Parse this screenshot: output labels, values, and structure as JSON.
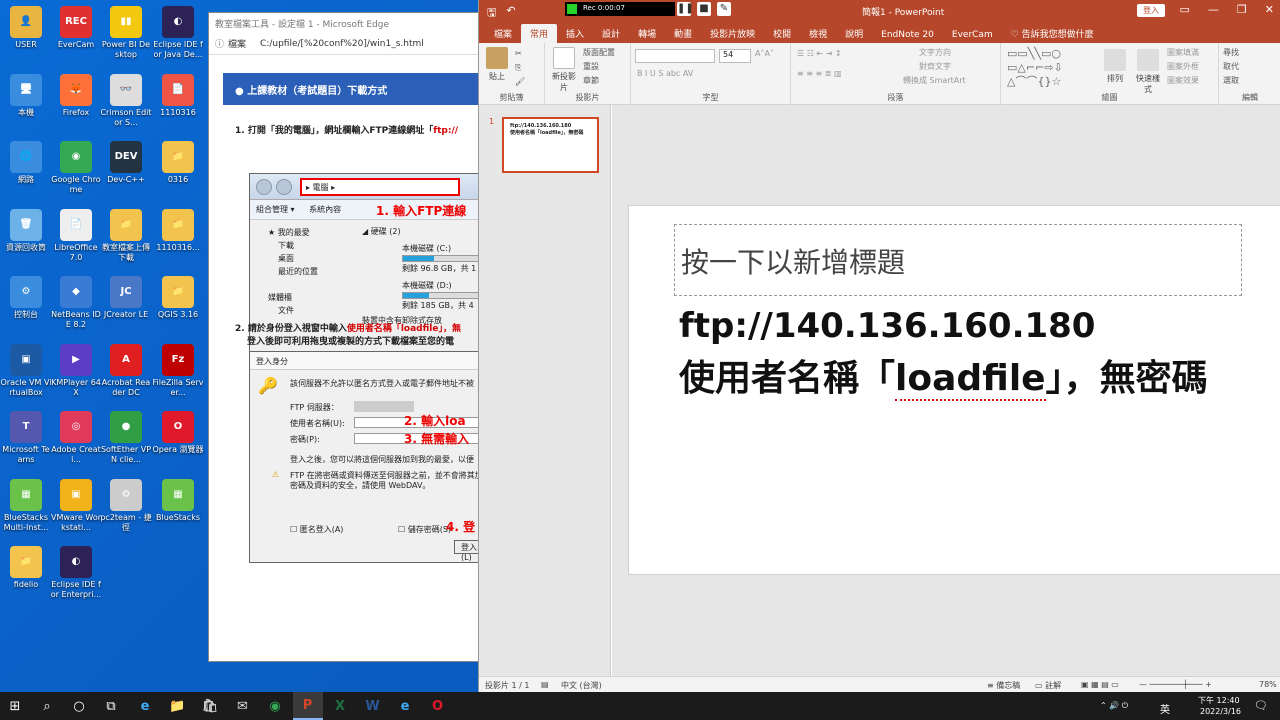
{
  "desktop": {
    "icons": [
      {
        "label": "USER",
        "glyph": "👤",
        "color": "#e8b640"
      },
      {
        "label": "EverCam",
        "glyph": "REC",
        "color": "#e03030"
      },
      {
        "label": "Power BI Desktop",
        "glyph": "▮▮",
        "color": "#f2c811"
      },
      {
        "label": "Eclipse IDE for Java De...",
        "glyph": "◐",
        "color": "#2c2255"
      },
      {
        "label": "本機",
        "glyph": "🖥",
        "color": "#3a8dde"
      },
      {
        "label": "Firefox",
        "glyph": "🦊",
        "color": "#ff7139"
      },
      {
        "label": "Crimson Editor S...",
        "glyph": "👓",
        "color": "#ddd"
      },
      {
        "label": "1110316",
        "glyph": "📄",
        "color": "#e54"
      },
      {
        "label": "網路",
        "glyph": "🌐",
        "color": "#3a8dde"
      },
      {
        "label": "Google Chrome",
        "glyph": "◉",
        "color": "#34a853"
      },
      {
        "label": "Dev-C++",
        "glyph": "DEV",
        "color": "#234"
      },
      {
        "label": "0316",
        "glyph": "📁",
        "color": "#f3c44d"
      },
      {
        "label": "資源回收筒",
        "glyph": "🗑",
        "color": "#6cb2e8"
      },
      {
        "label": "LibreOffice 7.0",
        "glyph": "📄",
        "color": "#eee"
      },
      {
        "label": "教室檔案上傳下載",
        "glyph": "📁",
        "color": "#f3c44d"
      },
      {
        "label": "1110316...",
        "glyph": "📁",
        "color": "#f3c44d"
      },
      {
        "label": "控制台",
        "glyph": "⚙",
        "color": "#3a8dde"
      },
      {
        "label": "NetBeans IDE 8.2",
        "glyph": "◆",
        "color": "#3a7bd5"
      },
      {
        "label": "JCreator LE",
        "glyph": "JC",
        "color": "#4a78c8"
      },
      {
        "label": "QGIS 3.16",
        "glyph": "📁",
        "color": "#f3c44d"
      },
      {
        "label": "Oracle VM VirtualBox",
        "glyph": "▣",
        "color": "#1c5aa6"
      },
      {
        "label": "KMPlayer 64X",
        "glyph": "▶",
        "color": "#5b3cc4"
      },
      {
        "label": "Acrobat Reader DC",
        "glyph": "A",
        "color": "#e02020"
      },
      {
        "label": "FileZilla Server...",
        "glyph": "Fz",
        "color": "#bf0000"
      },
      {
        "label": "Microsoft Teams",
        "glyph": "T",
        "color": "#5558af"
      },
      {
        "label": "Adobe Creati...",
        "glyph": "◎",
        "color": "#e03a5a"
      },
      {
        "label": "SoftEther VPN clie...",
        "glyph": "●",
        "color": "#2f9e44"
      },
      {
        "label": "Opera 瀏覽器",
        "glyph": "O",
        "color": "#e01a2a"
      },
      {
        "label": "BlueStacks Multi-Inst...",
        "glyph": "▦",
        "color": "#6bc24a"
      },
      {
        "label": "VMware Workstati...",
        "glyph": "▣",
        "color": "#f2b21a"
      },
      {
        "label": "pc2team - 捷徑",
        "glyph": "⚙",
        "color": "#ccc"
      },
      {
        "label": "BlueStacks",
        "glyph": "▦",
        "color": "#6bc24a"
      },
      {
        "label": "fidelio",
        "glyph": "📁",
        "color": "#f3c44d"
      },
      {
        "label": "Eclipse IDE for Enterpri...",
        "glyph": "◐",
        "color": "#2c2255"
      }
    ]
  },
  "edge": {
    "title": "教室檔案工具 - 設定檔 1 - Microsoft Edge",
    "addr_icon": "ⓘ",
    "addr_prefix": "檔案",
    "url": "C:/upfile/[%20conf%20]/win1_s.html",
    "banner": "上課教材（考試題目）下載方式",
    "step1_prefix": "1. 打開「我的電腦」，網址欄輸入FTP連線網址「",
    "step1_red": "ftp://",
    "explorer": {
      "address": "▸ 電腦 ▸",
      "menu_org": "組合管理 ▾",
      "menu_props": "系統內容",
      "callout": "1. 輸入FTP連線",
      "tree": [
        "★ 我的最愛",
        "下載",
        "桌面",
        "最近的位置",
        "",
        "媒體櫃",
        "文件"
      ],
      "drives_header": "◢ 硬碟 (2)",
      "drive_c": "本機磁碟 (C:)",
      "drive_c_free": "剩餘 96.8 GB，共 1",
      "drive_c_used": 0.35,
      "drive_d": "本機磁碟 (D:)",
      "drive_d_free": "剩餘 185 GB，共 4",
      "drive_d_used": 0.3,
      "drive_more": "裝置中含有卸除式存放"
    },
    "step2_prefix": "2. 請於身份登入視窗中輸入",
    "step2_red": "使用者名稱「loadfile」，無",
    "step2_line2": "登入後即可利用拖曳或複製的方式下載檔案至您的電",
    "login": {
      "title": "登入身分",
      "msg": "該伺服器不允許以匿名方式登入或電子郵件地址不被",
      "server_label": "FTP 伺服器：",
      "user_label": "使用者名稱(U):",
      "pass_label": "密碼(P):",
      "callout2": "2. 輸入loa",
      "callout3": "3. 無需輸入",
      "note": "登入之後，您可以將這個伺服器加到我的最愛，以便",
      "warn": "FTP 在將密碼或資料傳送至伺服器之前，並不會將其加",
      "warn2": "密碼及資料的安全，請使用 WebDAV。",
      "anon": "☐ 匿名登入(A)",
      "save": "☐ 儲存密碼(S)",
      "callout4": "4. 登",
      "login_btn": "登入(L)"
    }
  },
  "ppt": {
    "title": "簡報1 - PowerPoint",
    "login": "登入",
    "rec_time": "Rec 0:00:07",
    "tabs": [
      "檔案",
      "常用",
      "插入",
      "設計",
      "轉場",
      "動畫",
      "投影片放映",
      "校閱",
      "檢視",
      "說明",
      "EndNote 20",
      "EverCam",
      "♡ 告訴我您想做什麼"
    ],
    "ribbon": {
      "paste": "貼上",
      "clipboard": "剪貼簿",
      "new_slide": "新投影片",
      "layout": "版面配置",
      "reset": "重設",
      "section": "章節",
      "slides": "投影片",
      "font": "字型",
      "font_size": "54",
      "paragraph": "段落",
      "text_dir": "文字方向",
      "align_text": "對齊文字",
      "smartart": "轉換成 SmartArt",
      "drawing": "繪圖",
      "arrange": "排列",
      "quick_styles": "快速樣式",
      "shape_fill": "圖案填滿",
      "shape_outline": "圖案外框",
      "shape_effects": "圖案效果",
      "find": "尋找",
      "replace": "取代",
      "select": "選取",
      "editing": "編輯"
    },
    "thumb_num": "1",
    "thumb_line1": "ftp://140.136.160.180",
    "thumb_line2": "使用者名稱「loadfile」，無密碼",
    "slide": {
      "title_placeholder": "按一下以新增標題",
      "line1": "ftp://140.136.160.180",
      "line2_a": "使用者名稱「",
      "line2_b": "loadfile",
      "line2_c": "」，無密碼"
    },
    "status": {
      "slide": "投影片 1 / 1",
      "lang": "中文 (台灣)",
      "notes": "≡ 備忘稿",
      "comments": "▭ 註解",
      "zoom": "78%"
    }
  },
  "taskbar": {
    "start": "⊞",
    "search": "⌕",
    "cortana": "○",
    "taskview": "⧉",
    "apps": [
      "e",
      "📁",
      "🛍",
      "✉",
      "◉",
      "P",
      "X",
      "W",
      "e",
      "O"
    ],
    "ime": "英",
    "time": "下午 12:40",
    "date": "2022/3/16",
    "tray": "⌃ 🔊 ⏻"
  }
}
